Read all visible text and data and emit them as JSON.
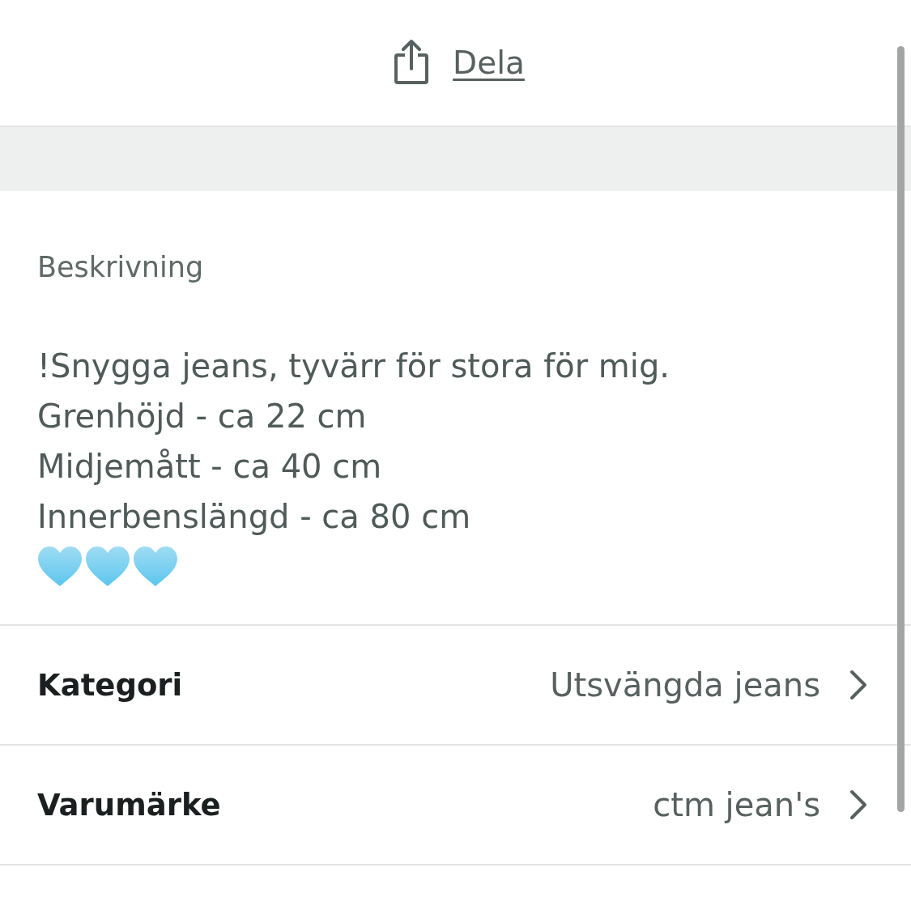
{
  "share": {
    "label": "Dela"
  },
  "description": {
    "heading": "Beskrivning",
    "text": "!Snygga jeans, tyvärr för stora för mig.\nGrenhöjd - ca 22 cm\nMidjemått - ca 40 cm\nInnerbenslängd - ca 80 cm",
    "emoji": [
      {
        "kind": "heart"
      },
      {
        "kind": "heart"
      },
      {
        "kind": "heart"
      }
    ]
  },
  "details": [
    {
      "label": "Kategori",
      "value": "Utsvängda jeans"
    },
    {
      "label": "Varumärke",
      "value": "ctm jean's"
    }
  ]
}
